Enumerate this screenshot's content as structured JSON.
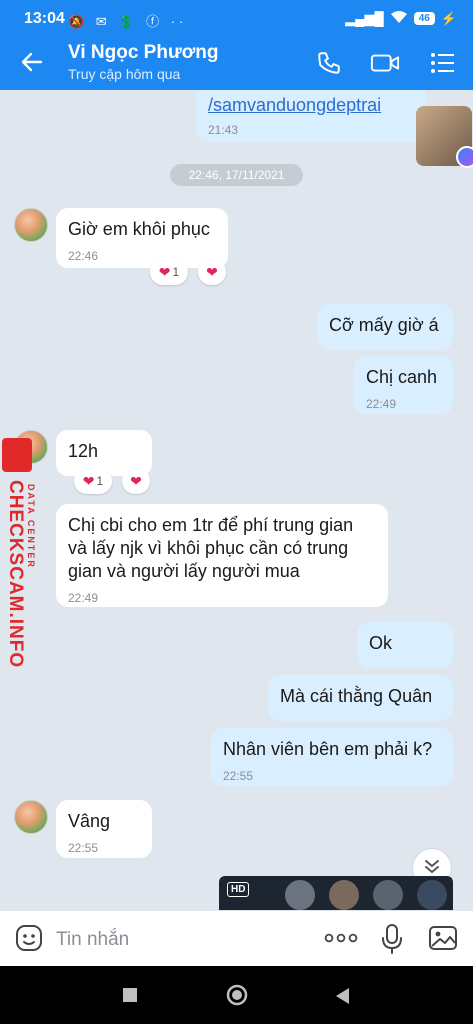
{
  "status_bar": {
    "time": "13:04",
    "battery": "46",
    "notification_icons": "🔕 ✉ 💲 ⓕ ··"
  },
  "header": {
    "title": "Vi Ngọc Phương",
    "subtitle": "Truy cập hôm qua",
    "icons": [
      "back-arrow-icon",
      "phone-icon",
      "video-call-icon",
      "menu-icon"
    ]
  },
  "date_separator": "22:46, 17/11/2021",
  "messages": [
    {
      "side": "out",
      "text": "/samvanduongdeptrai",
      "time": "21:43"
    },
    {
      "side": "in",
      "text": "Giờ em khôi phục",
      "time": "22:46",
      "reaction_count": "1"
    },
    {
      "side": "out",
      "text": "Cỡ mấy giờ á"
    },
    {
      "side": "out",
      "text": "Chị canh",
      "time": "22:49"
    },
    {
      "side": "in",
      "text": "12h",
      "reaction_count": "1"
    },
    {
      "side": "in",
      "text": "Chị cbi cho em 1tr để phí trung gian và lấy njk vì khôi phục cần có trung gian và người lấy người mua",
      "time": "22:49"
    },
    {
      "side": "out",
      "text": "Ok"
    },
    {
      "side": "out",
      "text": "Mà cái thằng Quân"
    },
    {
      "side": "out",
      "text": "Nhân viên bên em phải k?",
      "time": "22:55"
    },
    {
      "side": "in",
      "text": "Vâng",
      "time": "22:55"
    }
  ],
  "watermark": {
    "text": "CHECKSCAM.INFO",
    "sub": "DATA CENTER"
  },
  "video_preview": {
    "badge": "HD"
  },
  "input": {
    "placeholder": "Tin nhắn"
  },
  "colors": {
    "header_bg": "#1e88f2",
    "chat_bg": "#dfe6ee",
    "outgoing_bubble": "#d9eefe",
    "incoming_bubble": "#ffffff",
    "reaction_heart": "#e0245e",
    "watermark": "#e02a2a"
  }
}
